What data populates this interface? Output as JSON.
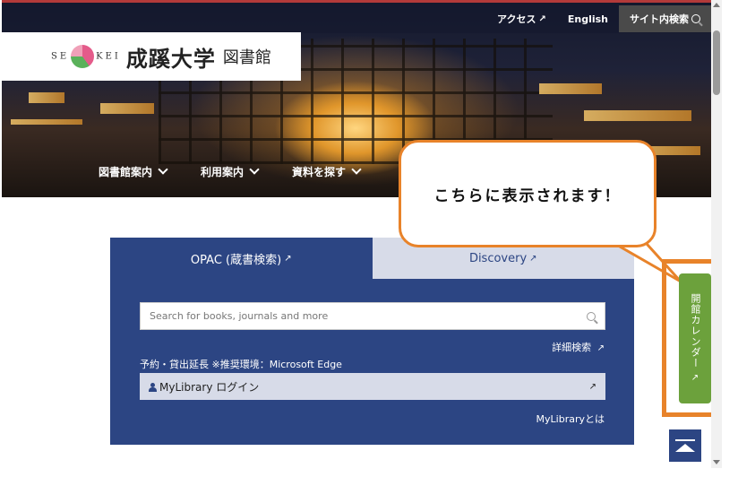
{
  "topnav": {
    "access_label": "アクセス",
    "english_label": "English",
    "site_search_label": "サイト内検索"
  },
  "logo": {
    "seikei_left": "SE",
    "seikei_right": "KEI",
    "univ_name": "成蹊大学",
    "lib_name": "図書館"
  },
  "mainnav": {
    "items": [
      {
        "label": "図書館案内"
      },
      {
        "label": "利用案内"
      },
      {
        "label": "資料を探す"
      }
    ]
  },
  "callout": {
    "text": "こちらに表示されます！"
  },
  "search_panel": {
    "tabs": [
      {
        "label": "OPAC (蔵書検索)"
      },
      {
        "label": "Discovery"
      }
    ],
    "search_placeholder": "Search for books, journals and more",
    "advanced_search": "詳細検索",
    "notice": "予約・貸出延長 ※推奨環境：Microsoft Edge",
    "mylibrary_login": "MyLibrary ログイン",
    "mylibrary_about": "MyLibraryとは"
  },
  "calendar": {
    "label": "開館カレンダー"
  },
  "icons": {
    "external_link": "↗",
    "search": "search-icon",
    "chevron": "chevron-down-icon"
  },
  "colors": {
    "panel_blue": "#2c4583",
    "tab_inactive": "#d7dbe8",
    "calendar_green": "#6ca13c",
    "highlight_orange": "#e8832a"
  }
}
